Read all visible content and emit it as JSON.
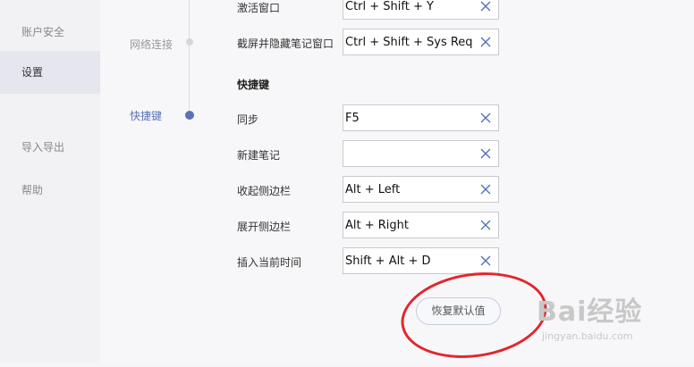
{
  "sidebar": {
    "items": [
      {
        "label": "账户安全"
      },
      {
        "label": "设置"
      },
      {
        "label": "导入导出"
      },
      {
        "label": "帮助"
      }
    ]
  },
  "anchors": {
    "network": "网络连接",
    "shortcuts": "快捷键"
  },
  "rows_top": [
    {
      "label": "激活窗口",
      "value": "Ctrl + Shift + Y"
    },
    {
      "label": "截屏并隐藏笔记窗口",
      "value": "Ctrl + Shift + Sys Req"
    }
  ],
  "section": {
    "title": "快捷键"
  },
  "rows": [
    {
      "label": "同步",
      "value": "F5"
    },
    {
      "label": "新建笔记",
      "value": ""
    },
    {
      "label": "收起侧边栏",
      "value": "Alt + Left"
    },
    {
      "label": "展开侧边栏",
      "value": "Alt + Right"
    },
    {
      "label": "插入当前时间",
      "value": "Shift + Alt + D"
    }
  ],
  "restore_button": {
    "label": "恢复默认值"
  },
  "watermark": {
    "logo": "Bai经验",
    "url": "jingyan.baidu.com"
  },
  "colors": {
    "accent": "#5a73b6",
    "annotation": "#e3262c"
  }
}
